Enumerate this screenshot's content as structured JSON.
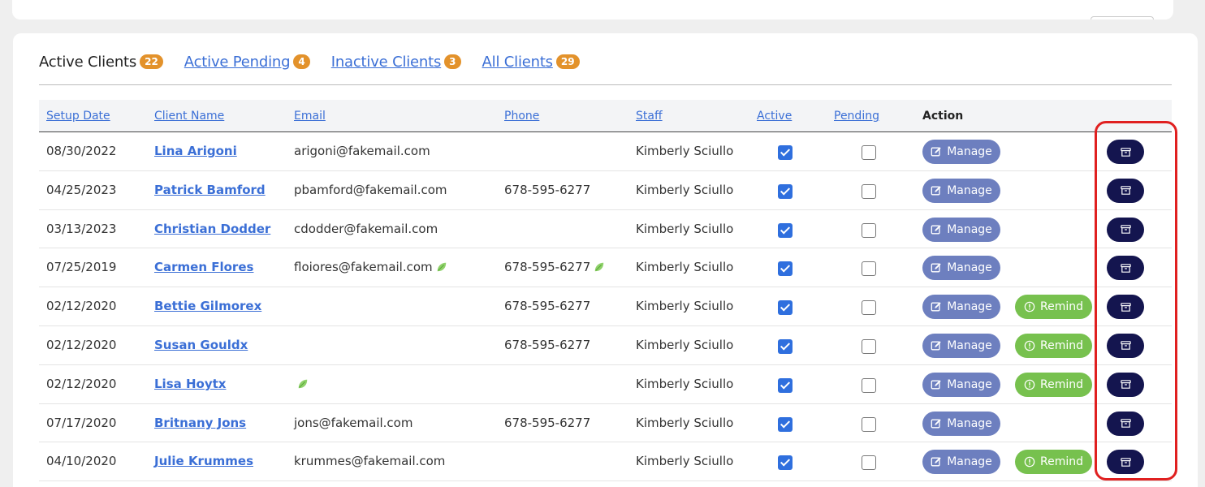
{
  "tabs": [
    {
      "label": "Active Clients",
      "count": "22"
    },
    {
      "label": "Active Pending",
      "count": "4"
    },
    {
      "label": "Inactive Clients",
      "count": "3"
    },
    {
      "label": "All Clients",
      "count": "29"
    }
  ],
  "headers": {
    "setup_date": "Setup Date",
    "client_name": "Client Name",
    "email": "Email",
    "phone": "Phone",
    "staff": "Staff",
    "active": "Active",
    "pending": "Pending",
    "action": "Action"
  },
  "buttons": {
    "manage": "Manage",
    "remind": "Remind"
  },
  "colors": {
    "badge": "#e3922b",
    "link": "#3b6fd6",
    "manage": "#6d7fbf",
    "remind": "#77c14e",
    "archive": "#14154f",
    "highlight": "#e02020"
  },
  "rows": [
    {
      "date": "08/30/2022",
      "name": "Lina Arigoni",
      "email": "arigoni@fakemail.com",
      "email_leaf": false,
      "phone": "",
      "phone_leaf": false,
      "staff": "Kimberly Sciullo",
      "active": true,
      "pending": false,
      "remind": false
    },
    {
      "date": "04/25/2023",
      "name": "Patrick Bamford",
      "email": "pbamford@fakemail.com",
      "email_leaf": false,
      "phone": "678-595-6277",
      "phone_leaf": false,
      "staff": "Kimberly Sciullo",
      "active": true,
      "pending": false,
      "remind": false
    },
    {
      "date": "03/13/2023",
      "name": "Christian Dodder",
      "email": "cdodder@fakemail.com",
      "email_leaf": false,
      "phone": "",
      "phone_leaf": false,
      "staff": "Kimberly Sciullo",
      "active": true,
      "pending": false,
      "remind": false
    },
    {
      "date": "07/25/2019",
      "name": "Carmen Flores",
      "email": "floiores@fakemail.com",
      "email_leaf": true,
      "phone": "678-595-6277",
      "phone_leaf": true,
      "staff": "Kimberly Sciullo",
      "active": true,
      "pending": false,
      "remind": false
    },
    {
      "date": "02/12/2020",
      "name": "Bettie Gilmorex",
      "email": "",
      "email_leaf": false,
      "phone": "678-595-6277",
      "phone_leaf": false,
      "staff": "Kimberly Sciullo",
      "active": true,
      "pending": false,
      "remind": true
    },
    {
      "date": "02/12/2020",
      "name": "Susan Gouldx",
      "email": "",
      "email_leaf": false,
      "phone": "678-595-6277",
      "phone_leaf": false,
      "staff": "Kimberly Sciullo",
      "active": true,
      "pending": false,
      "remind": true
    },
    {
      "date": "02/12/2020",
      "name": "Lisa Hoytx",
      "email": "",
      "email_leaf": true,
      "phone": "",
      "phone_leaf": false,
      "staff": "Kimberly Sciullo",
      "active": true,
      "pending": false,
      "remind": true
    },
    {
      "date": "07/17/2020",
      "name": "Britnany Jons",
      "email": "jons@fakemail.com",
      "email_leaf": false,
      "phone": "678-595-6277",
      "phone_leaf": false,
      "staff": "Kimberly Sciullo",
      "active": true,
      "pending": false,
      "remind": false
    },
    {
      "date": "04/10/2020",
      "name": "Julie Krummes",
      "email": "krummes@fakemail.com",
      "email_leaf": false,
      "phone": "",
      "phone_leaf": false,
      "staff": "Kimberly Sciullo",
      "active": true,
      "pending": false,
      "remind": true
    }
  ]
}
